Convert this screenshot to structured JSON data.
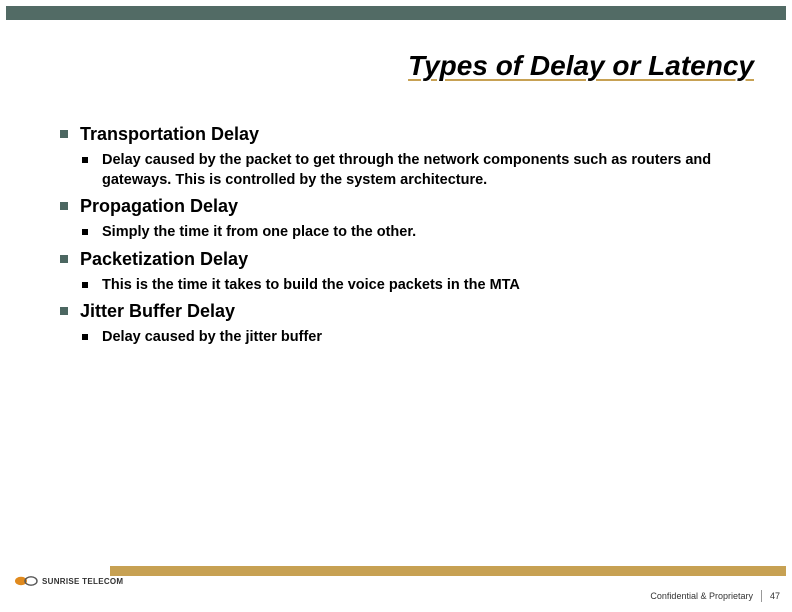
{
  "slide": {
    "title": "Types of Delay or Latency",
    "items": [
      {
        "heading": "Transportation Delay",
        "subs": [
          "Delay caused by the packet to get through the network components such as routers and gateways.  This is controlled by the system architecture."
        ]
      },
      {
        "heading": "Propagation Delay",
        "subs": [
          "Simply the time it from one place to the other."
        ]
      },
      {
        "heading": "Packetization Delay",
        "subs": [
          "This is the time it takes to build the voice packets in the MTA"
        ]
      },
      {
        "heading": "Jitter Buffer Delay",
        "subs": [
          "Delay caused by the jitter buffer"
        ]
      }
    ]
  },
  "footer": {
    "logo_text": "SUNRISE TELECOM",
    "confidential": "Confidential & Proprietary",
    "page": "47"
  },
  "colors": {
    "header_bar": "#526b65",
    "accent": "#c7a153"
  }
}
